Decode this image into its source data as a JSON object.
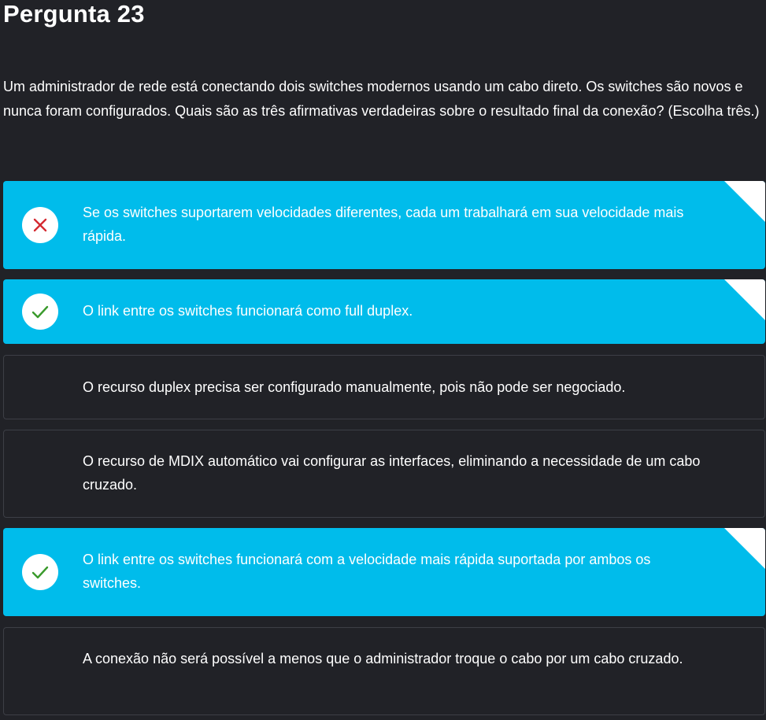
{
  "title": "Pergunta 23",
  "question": "Um administrador de rede está conectando dois switches modernos usando um cabo direto. Os switches são novos e nunca foram configurados. Quais são as três afirmativas verdadeiras sobre o resultado final da conexão? (Escolha três.)",
  "options": [
    {
      "text": "Se os switches suportarem velocidades diferentes, cada um trabalhará em sua velocidade mais rápida.",
      "selected": true,
      "status": "incorrect",
      "status_icon": "x-icon"
    },
    {
      "text": "O link entre os switches funcionará como full duplex.",
      "selected": true,
      "status": "correct",
      "status_icon": "check-icon"
    },
    {
      "text": "O recurso duplex precisa ser configurado manualmente, pois não pode ser negociado.",
      "selected": false
    },
    {
      "text": "O recurso de MDIX automático vai configurar as interfaces, eliminando a necessidade de um cabo cruzado.",
      "selected": false
    },
    {
      "text": "O link entre os switches funcionará com a velocidade mais rápida suportada por ambos os switches.",
      "selected": true,
      "status": "correct",
      "status_icon": "check-icon"
    },
    {
      "text": "A conexão não será possível a menos que o administrador troque o cabo por um cabo cruzado.",
      "selected": false
    }
  ],
  "colors": {
    "background": "#212227",
    "selected_option": "#00bceb",
    "unselected_border": "#3d3f46",
    "correct": "#3a9a2c",
    "incorrect": "#d42a31"
  }
}
